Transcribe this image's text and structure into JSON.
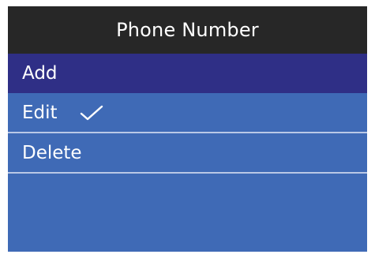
{
  "title": "Phone Number",
  "menu": {
    "items": [
      {
        "label": "Add",
        "selected": true,
        "checked": false
      },
      {
        "label": "Edit",
        "selected": false,
        "checked": true
      },
      {
        "label": "Delete",
        "selected": false,
        "checked": false
      }
    ]
  },
  "icons": {
    "check": "checkmark-icon"
  },
  "colors": {
    "title_background": "#272727",
    "menu_background": "#3f6ab6",
    "selected_background": "#2f2f86",
    "divider": "#b9c8e6",
    "text": "#ffffff"
  }
}
